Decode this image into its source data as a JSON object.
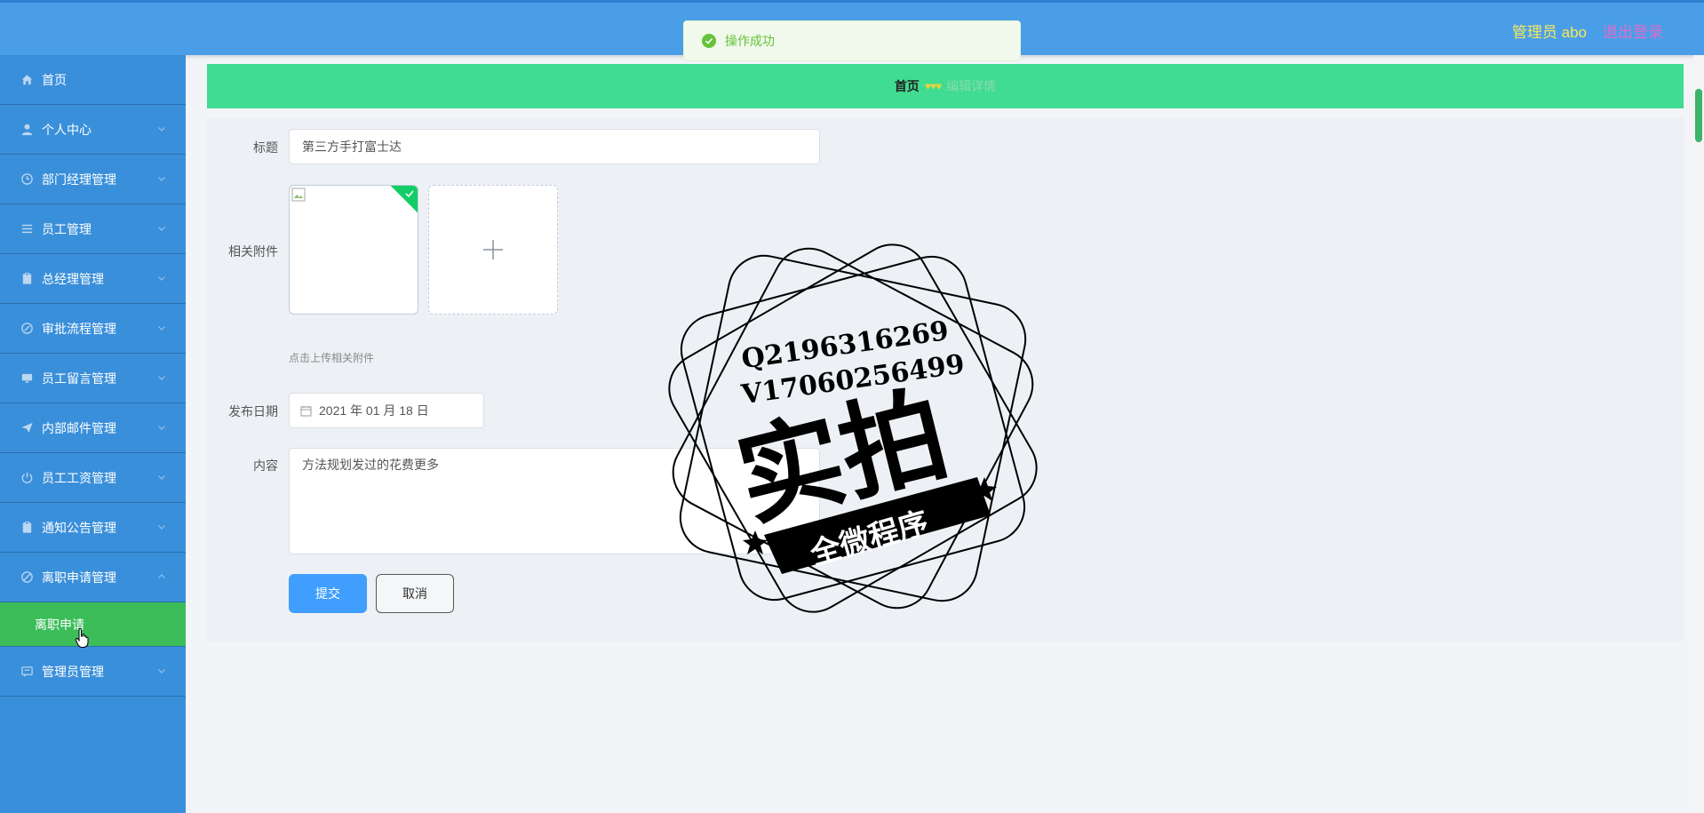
{
  "header": {
    "user_label": "管理员 abo",
    "logout_label": "退出登录"
  },
  "toast": {
    "message": "操作成功"
  },
  "sidebar": {
    "items": [
      {
        "label": "首页",
        "icon": "home-icon"
      },
      {
        "label": "个人中心",
        "icon": "user-icon"
      },
      {
        "label": "部门经理管理",
        "icon": "clock-icon"
      },
      {
        "label": "员工管理",
        "icon": "menu-icon"
      },
      {
        "label": "总经理管理",
        "icon": "clipboard-icon"
      },
      {
        "label": "审批流程管理",
        "icon": "compass-icon"
      },
      {
        "label": "员工留言管理",
        "icon": "monitor-icon"
      },
      {
        "label": "内部邮件管理",
        "icon": "send-icon"
      },
      {
        "label": "员工工资管理",
        "icon": "power-icon"
      },
      {
        "label": "通知公告管理",
        "icon": "clipboard-icon"
      },
      {
        "label": "离职申请管理",
        "icon": "no-entry-icon"
      },
      {
        "label": "管理员管理",
        "icon": "chat-icon"
      }
    ],
    "active_sub_item": "离职申请"
  },
  "breadcrumb": {
    "home": "首页",
    "separator": "♥♥♥",
    "current": "编辑详情"
  },
  "form": {
    "title_label": "标题",
    "title_value": "第三方手打富士达",
    "attachment_label": "相关附件",
    "attachment_hint": "点击上传相关附件",
    "date_label": "发布日期",
    "date_value": "2021 年 01 月 18 日",
    "content_label": "内容",
    "content_value": "方法规划发过的花费更多",
    "submit_label": "提交",
    "cancel_label": "取消"
  },
  "watermark": {
    "line1": "Q2196316269",
    "line2": "V17060256499",
    "main": "实拍",
    "ribbon": "全微程序"
  },
  "colors": {
    "header": "#4a9ee8",
    "sidebar": "#3a8fda",
    "active_sub": "#3cbd5a",
    "breadcrumb": "#3fdc91",
    "primary": "#409eff",
    "user_label": "#f5e85b",
    "logout": "#e06cc9"
  }
}
